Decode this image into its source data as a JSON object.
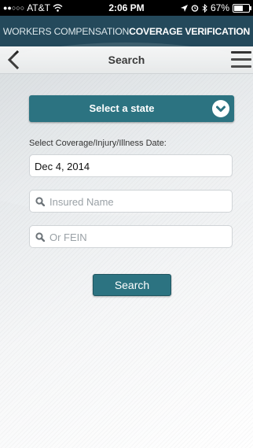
{
  "status_bar": {
    "carrier": "AT&T",
    "time": "2:06 PM",
    "battery": "67%",
    "battery_level": 0.67
  },
  "banner": {
    "prefix": "WORKERS COMPENSATION ",
    "emphasis": "COVERAGE VERIFICATION"
  },
  "nav": {
    "title": "Search"
  },
  "form": {
    "state_select_label": "Select a state",
    "date_label": "Select Coverage/Injury/Illness Date:",
    "date_value": "Dec 4, 2014",
    "insured_name_placeholder": "Insured Name",
    "fein_placeholder": "Or FEIN",
    "search_label": "Search"
  },
  "colors": {
    "banner_bg": "#24495b",
    "accent": "#2c7381"
  },
  "icons": [
    "signal-dots-icon",
    "wifi-icon",
    "location-arrow-icon",
    "alarm-icon",
    "bluetooth-icon",
    "battery-icon",
    "back-chevron-icon",
    "hamburger-menu-icon",
    "chevron-down-icon",
    "search-icon"
  ]
}
